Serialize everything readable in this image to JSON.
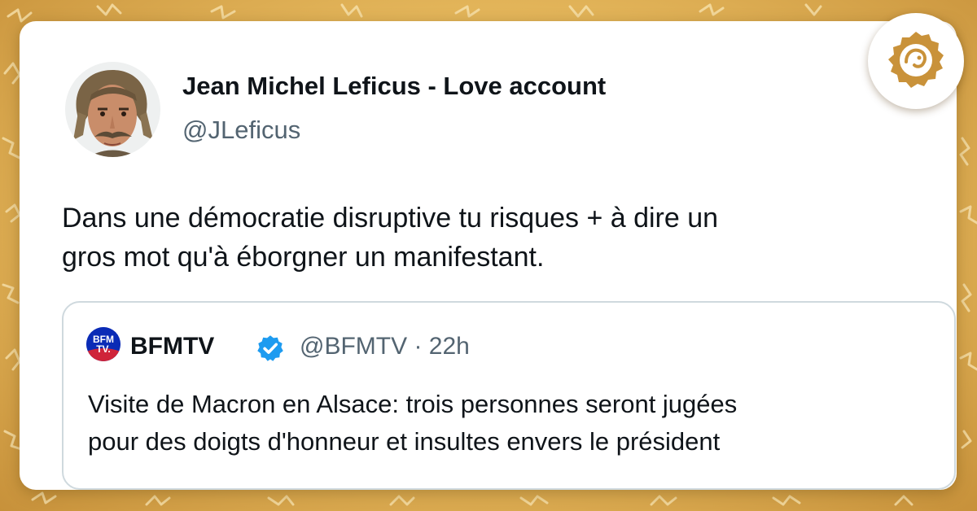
{
  "tweet": {
    "author": {
      "display_name": "Jean Michel Leficus - Love account",
      "handle": "@JLeficus"
    },
    "text_lines": [
      "Dans une démocratie disruptive tu risques + à dire un",
      "gros mot qu'à éborgner un manifestant."
    ]
  },
  "quoted_tweet": {
    "logo_text_top": "BFM",
    "logo_text_bottom": "TV.",
    "display_name": "BFMTV",
    "verified": true,
    "meta": "@BFMTV · 22h",
    "text_lines": [
      "Visite de Macron en Alsace: trois personnes seront jugées",
      "pour des doigts d'honneur et insultes envers le président"
    ]
  },
  "colors": {
    "background": "#e3b55a",
    "name_text": "#0f1419",
    "secondary_text": "#536471",
    "verified_blue": "#1d9bf0",
    "bfm_blue": "#0a2bb6",
    "brand_gold": "#c9923a"
  },
  "icons": {
    "verified": "verified-badge-icon",
    "brand": "brand-logo-icon"
  }
}
